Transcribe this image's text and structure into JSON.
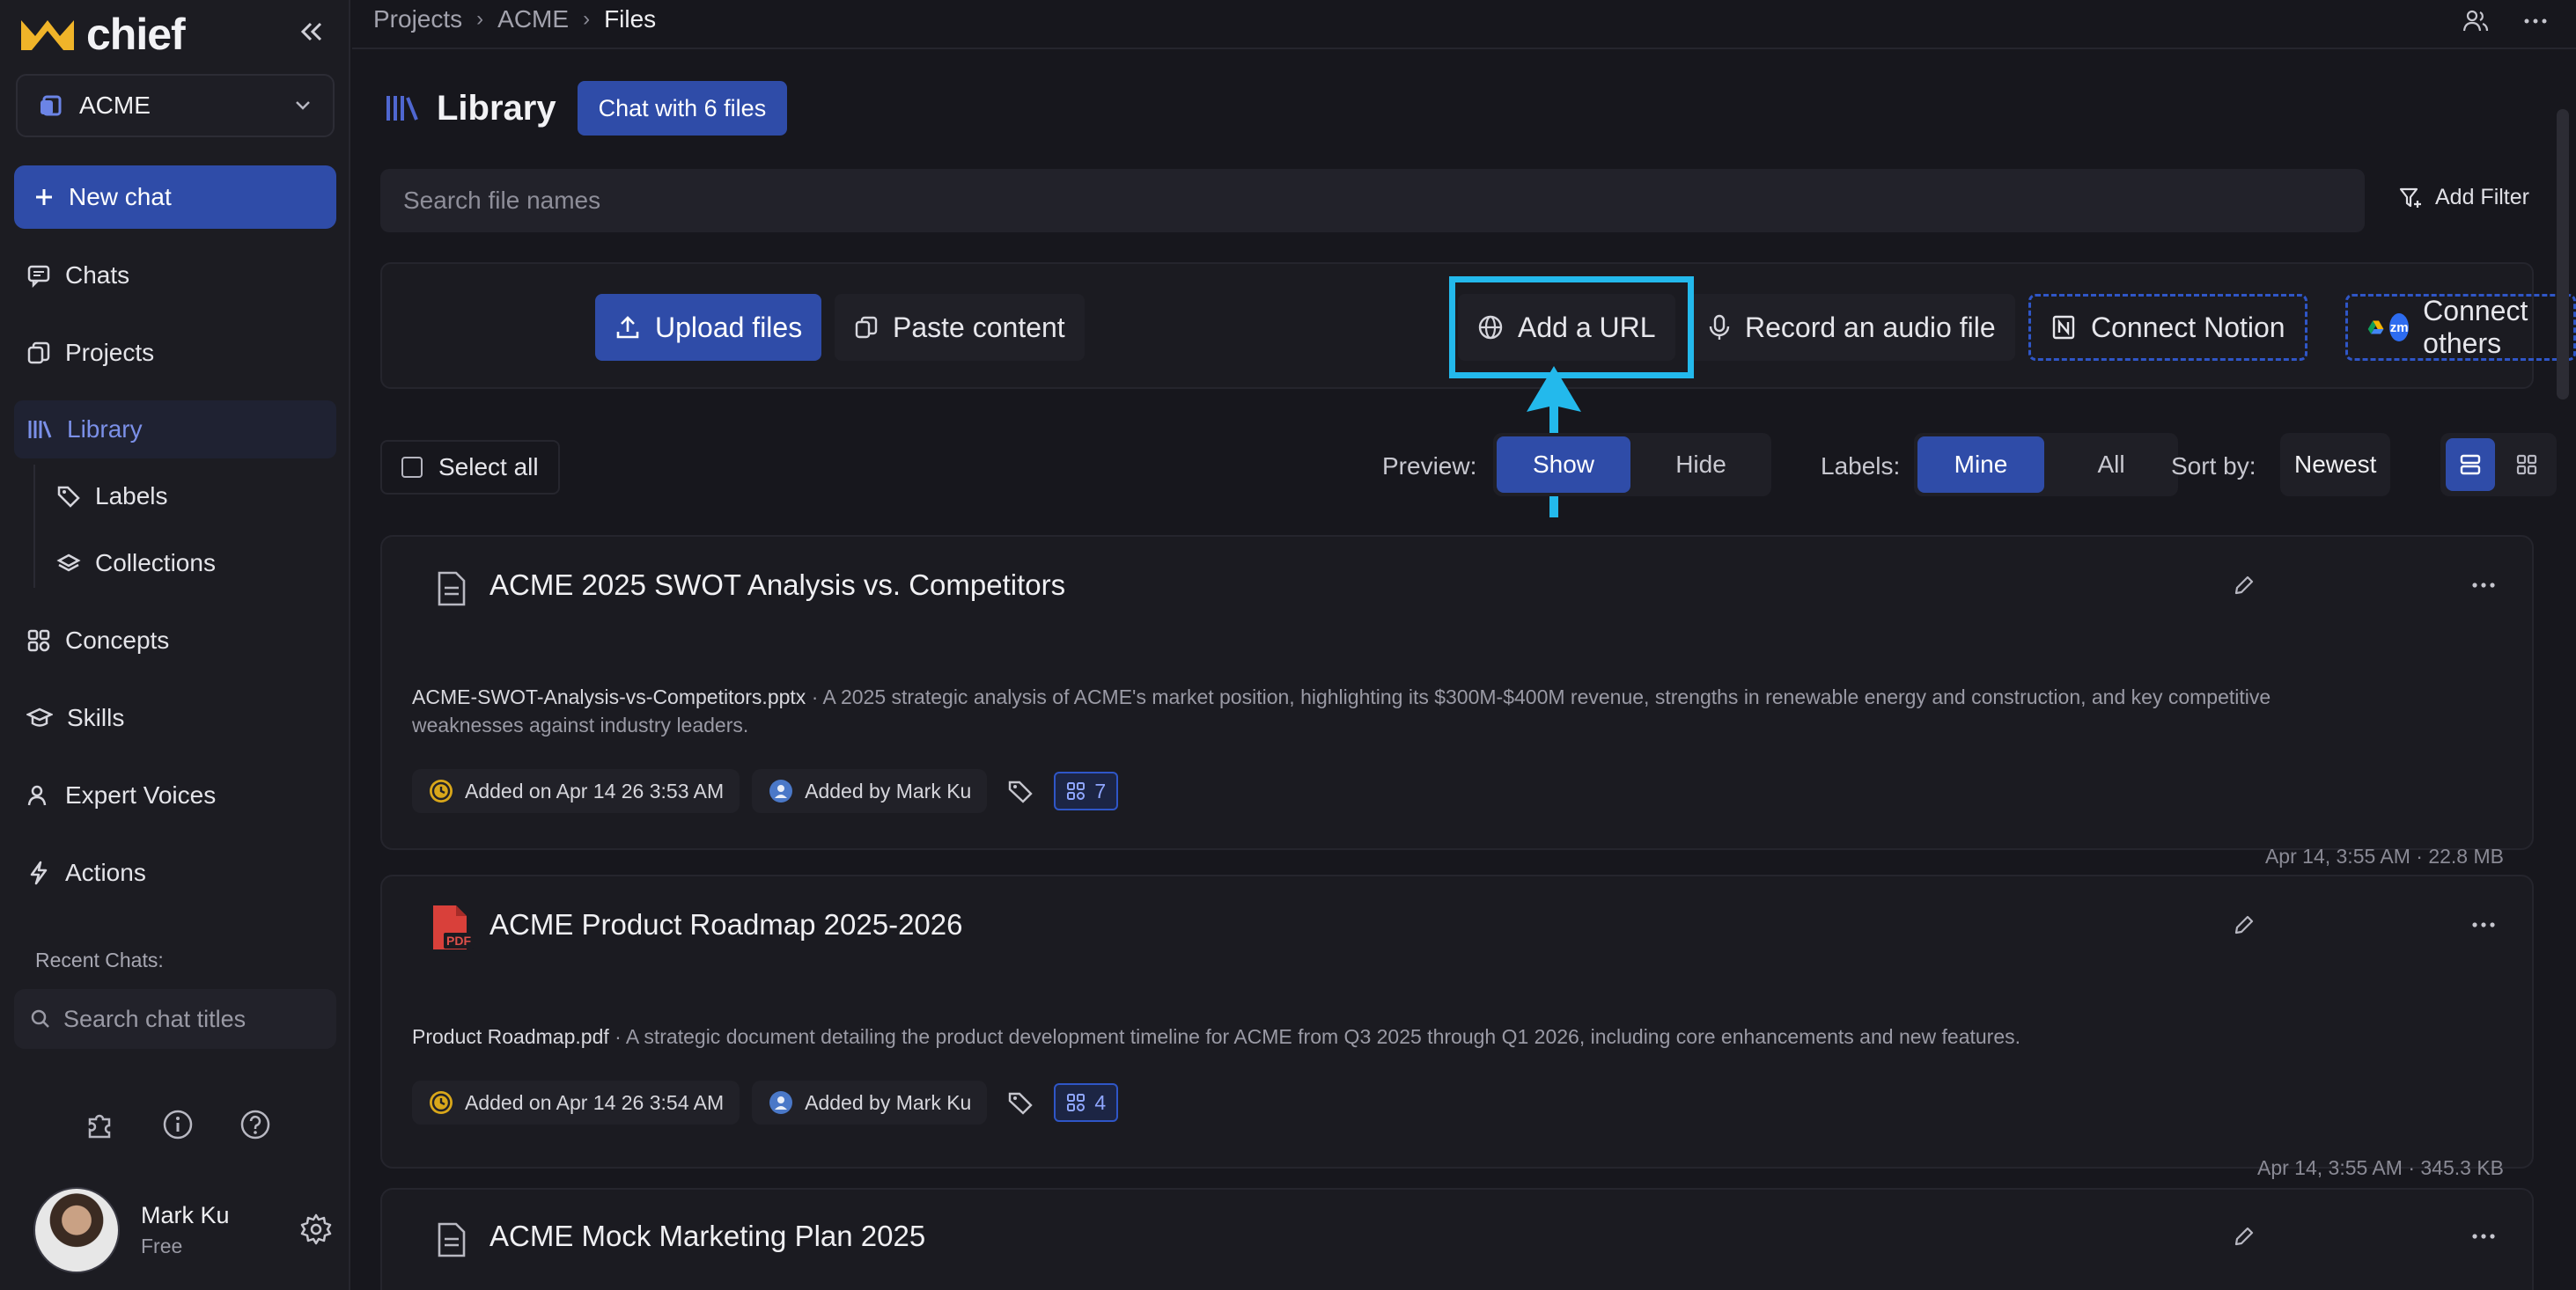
{
  "app": {
    "name": "chief",
    "brand_color": "#f0b429",
    "accent_color": "#2f4ca8"
  },
  "sidebar": {
    "workspace": "ACME",
    "new_chat": "New chat",
    "nav": [
      {
        "label": "Chats",
        "icon": "chat-bubble-icon"
      },
      {
        "label": "Projects",
        "icon": "projects-icon"
      },
      {
        "label": "Library",
        "icon": "library-icon",
        "active": true
      },
      {
        "label": "Labels",
        "icon": "tag-icon"
      },
      {
        "label": "Collections",
        "icon": "layers-icon"
      },
      {
        "label": "Concepts",
        "icon": "concepts-icon"
      },
      {
        "label": "Skills",
        "icon": "graduation-cap-icon"
      },
      {
        "label": "Expert Voices",
        "icon": "person-voice-icon"
      },
      {
        "label": "Actions",
        "icon": "lightning-icon"
      }
    ],
    "recent_title": "Recent Chats:",
    "search_placeholder": "Search chat titles",
    "user": {
      "name": "Mark Ku",
      "plan": "Free"
    }
  },
  "breadcrumb": [
    "Projects",
    "ACME",
    "Files"
  ],
  "library": {
    "title": "Library",
    "chat_button": "Chat with 6 files",
    "search_placeholder": "Search file names",
    "add_filter": "Add Filter",
    "actions": {
      "upload": "Upload files",
      "paste": "Paste content",
      "url": "Add a URL",
      "audio": "Record an audio file",
      "notion": "Connect Notion",
      "others": "Connect others",
      "others_badge": "zm"
    },
    "controls": {
      "select_all": "Select all",
      "preview_label": "Preview:",
      "preview_options": [
        "Show",
        "Hide"
      ],
      "preview_selected": "Show",
      "labels_label": "Labels:",
      "labels_options": [
        "Mine",
        "All"
      ],
      "labels_selected": "Mine",
      "sort_label": "Sort by:",
      "sort_value": "Newest"
    },
    "files": [
      {
        "title": "ACME 2025 SWOT Analysis vs. Competitors",
        "filename": "ACME-SWOT-Analysis-vs-Competitors.pptx",
        "description": " · A 2025 strategic analysis of ACME's market position, highlighting its $300M-$400M revenue, strengths in renewable energy and construction, and key competitive weaknesses against industry leaders.",
        "added_on": "Added on Apr 14 26 3:53 AM",
        "added_by": "Added by Mark Ku",
        "count": "7",
        "meta": "Apr 14, 3:55 AM · 22.8 MB",
        "icon": "document-icon"
      },
      {
        "title": "ACME Product Roadmap 2025-2026",
        "filename": "Product Roadmap.pdf",
        "description": " · A strategic document detailing the product development timeline for ACME from Q3 2025 through Q1 2026, including core enhancements and new features.",
        "added_on": "Added on Apr 14 26 3:54 AM",
        "added_by": "Added by Mark Ku",
        "count": "4",
        "meta": "Apr 14, 3:55 AM · 345.3 KB",
        "icon": "pdf-icon"
      },
      {
        "title": "ACME Mock Marketing Plan 2025",
        "icon": "document-icon"
      }
    ]
  }
}
